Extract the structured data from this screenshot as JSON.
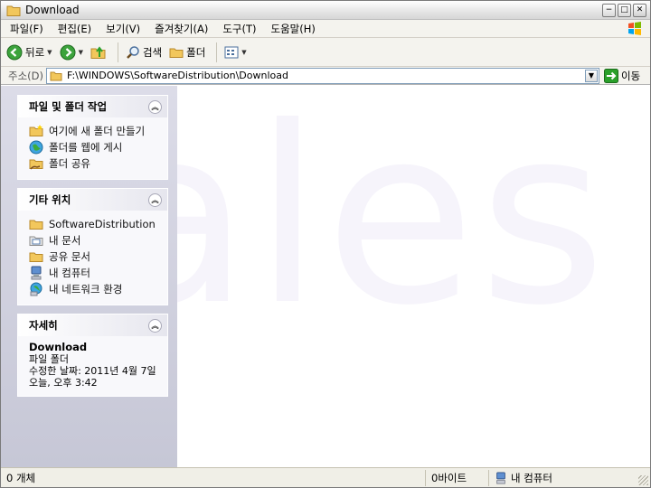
{
  "window": {
    "title": "Download",
    "minimize_glyph": "−",
    "maximize_glyph": "□",
    "close_glyph": "✕"
  },
  "menu": [
    "파일(F)",
    "편집(E)",
    "보기(V)",
    "즐겨찾기(A)",
    "도구(T)",
    "도움말(H)"
  ],
  "toolbar": {
    "back_label": "뒤로",
    "search_label": "검색",
    "folders_label": "폴더"
  },
  "address": {
    "label": "주소(D)",
    "path": "F:\\WINDOWS\\SoftwareDistribution\\Download",
    "go_label": "이동"
  },
  "panels": {
    "tasks": {
      "title": "파일 및 폴더 작업",
      "items": [
        "여기에 새 폴더 만들기",
        "폴더를 웹에 게시",
        "폴더 공유"
      ]
    },
    "places": {
      "title": "기타 위치",
      "items": [
        "SoftwareDistribution",
        "내 문서",
        "공유 문서",
        "내 컴퓨터",
        "내 네트워크 환경"
      ]
    },
    "details": {
      "title": "자세히",
      "name": "Download",
      "type": "파일 폴더",
      "modified_line1": "수정한 날짜: 2011년 4월 7일",
      "modified_line2": "오늘, 오후 3:42"
    }
  },
  "content": {
    "watermark": "ales"
  },
  "status": {
    "objects": "0 개체",
    "size": "0바이트",
    "location": "내 컴퓨터"
  },
  "colors": {
    "folder": "#f2c75c",
    "go_green": "#2aa02a",
    "taskpane": "#c6c7d6"
  }
}
